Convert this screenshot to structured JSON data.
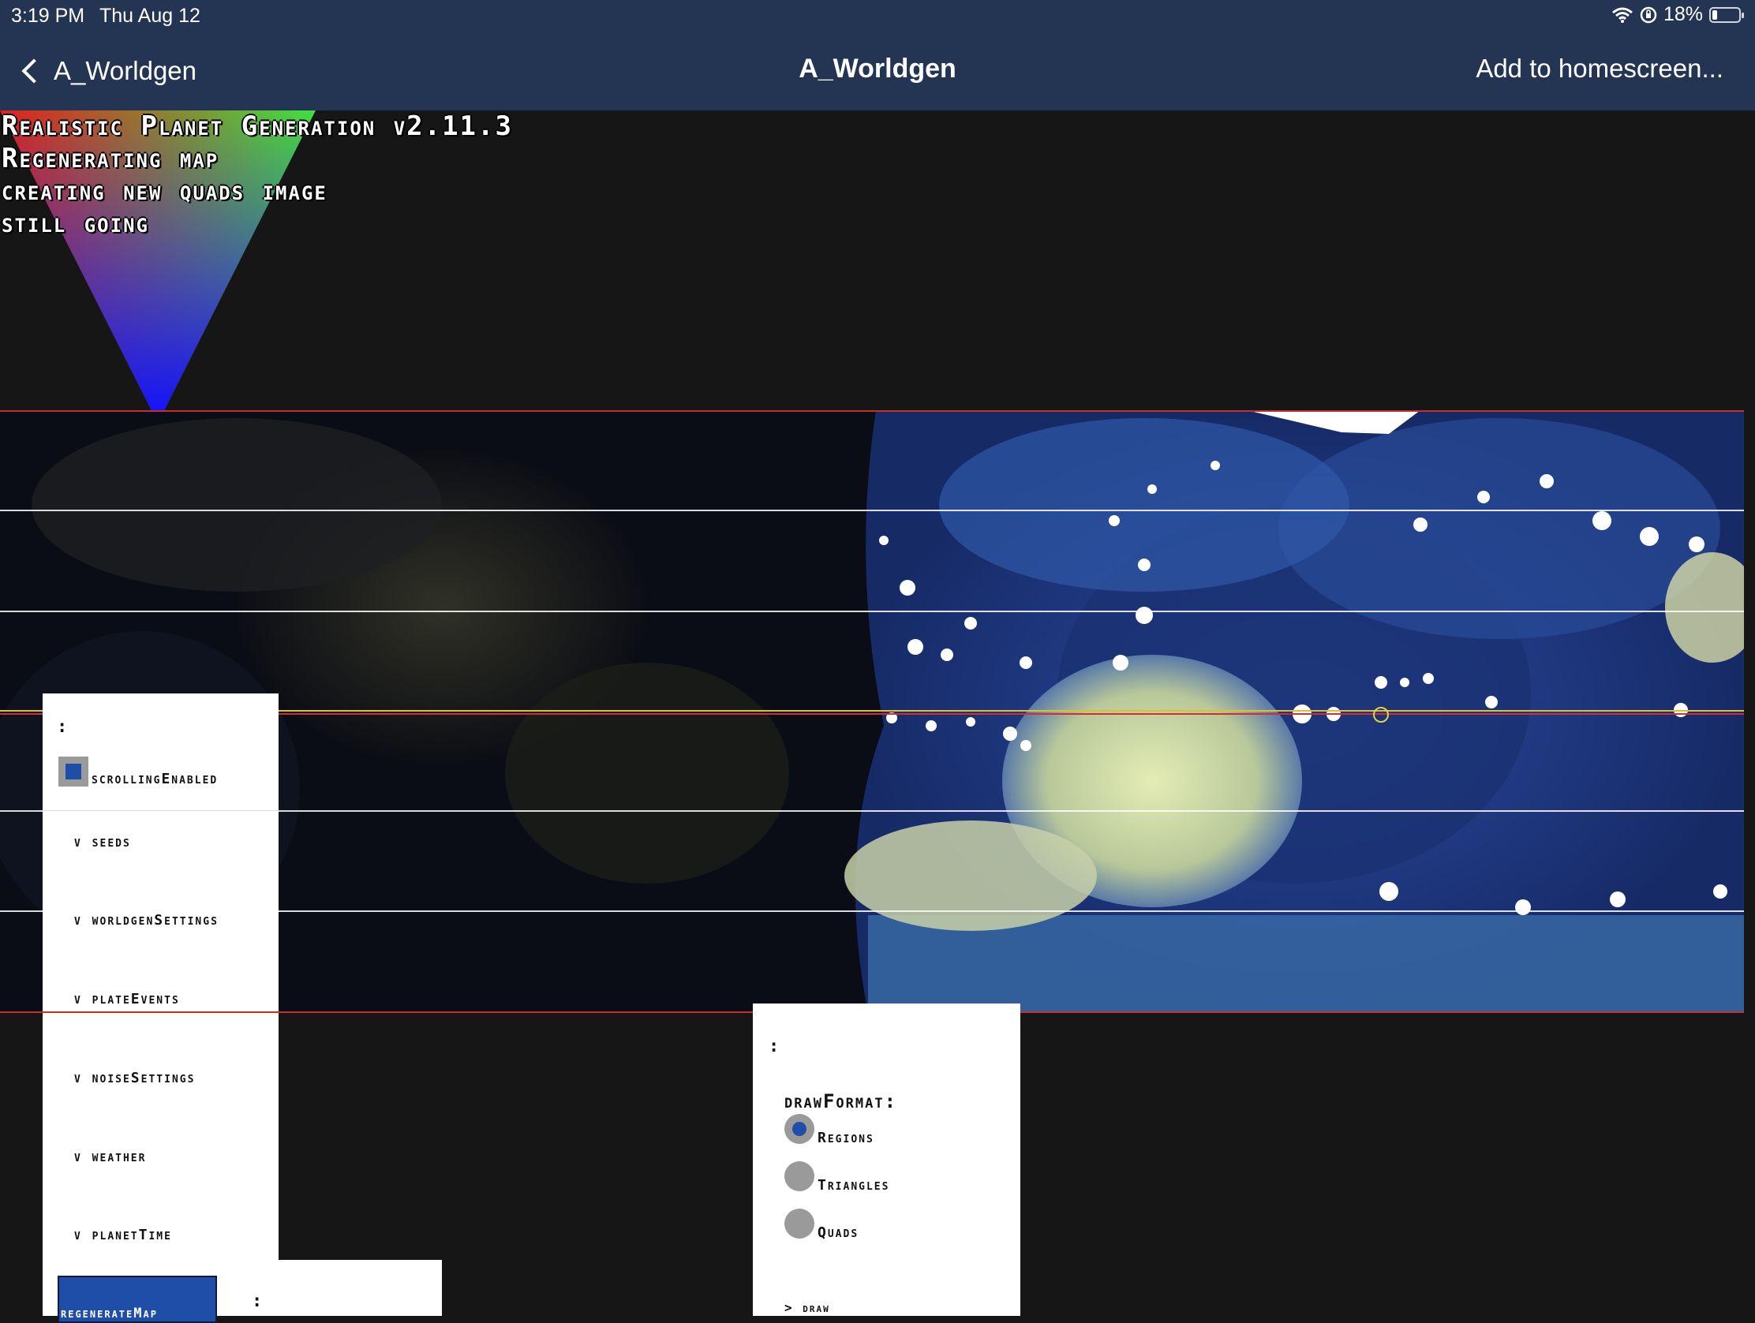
{
  "status_bar": {
    "time": "3:19 PM",
    "date": "Thu Aug 12",
    "battery": "18%",
    "battery_level": 0.18
  },
  "nav": {
    "back_label": "A_Worldgen",
    "title": "A_Worldgen",
    "add_label": "Add to homescreen..."
  },
  "log": [
    "Realistic Planet Generation v2.11.3",
    "Regenerating map",
    "creating new quads image",
    "still going"
  ],
  "settings_panel": {
    "colon": ":",
    "scrolling_label": "scrollingEnabled",
    "scrolling_checked": true,
    "items": [
      "v seeds",
      "v worldgenSettings",
      "v plateEvents",
      "v noiseSettings",
      "v weather",
      "v planetTime"
    ]
  },
  "regen_button": "regenerateMap",
  "small_panel": {
    "colon": ":"
  },
  "draw_panel": {
    "colon": ":",
    "title": "drawFormat:",
    "options": [
      "Regions",
      "Triangles",
      "Quads"
    ],
    "selected": "Regions",
    "draw_label": "> draw"
  },
  "colors": {
    "nav_bg": "#243553",
    "accent": "#1e4ea8",
    "map_border": "#c83030"
  }
}
